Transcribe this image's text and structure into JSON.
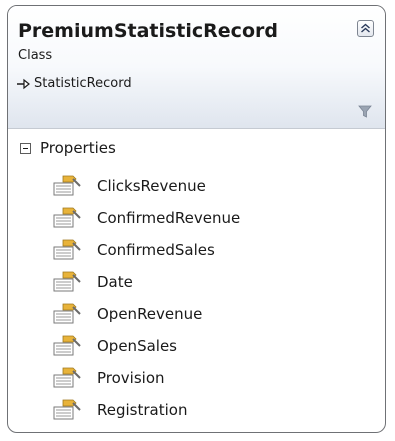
{
  "class_box": {
    "title": "PremiumStatisticRecord",
    "stereotype": "Class",
    "base_class": "StatisticRecord"
  },
  "compartment": {
    "label": "Properties",
    "items": [
      {
        "label": "ClicksRevenue"
      },
      {
        "label": "ConfirmedRevenue"
      },
      {
        "label": "ConfirmedSales"
      },
      {
        "label": "Date"
      },
      {
        "label": "OpenRevenue"
      },
      {
        "label": "OpenSales"
      },
      {
        "label": "Provision"
      },
      {
        "label": "Registration"
      }
    ]
  },
  "icons": {
    "collapse": "double-chevron-up-icon",
    "inherit": "inheritance-arrow-icon",
    "filter": "filter-icon",
    "property": "property-icon",
    "expander": "minus-box-icon"
  },
  "colors": {
    "border": "#6f7175",
    "header_gradient_end": "#dfe5ee",
    "property_icon_accent": "#e8b33a"
  }
}
